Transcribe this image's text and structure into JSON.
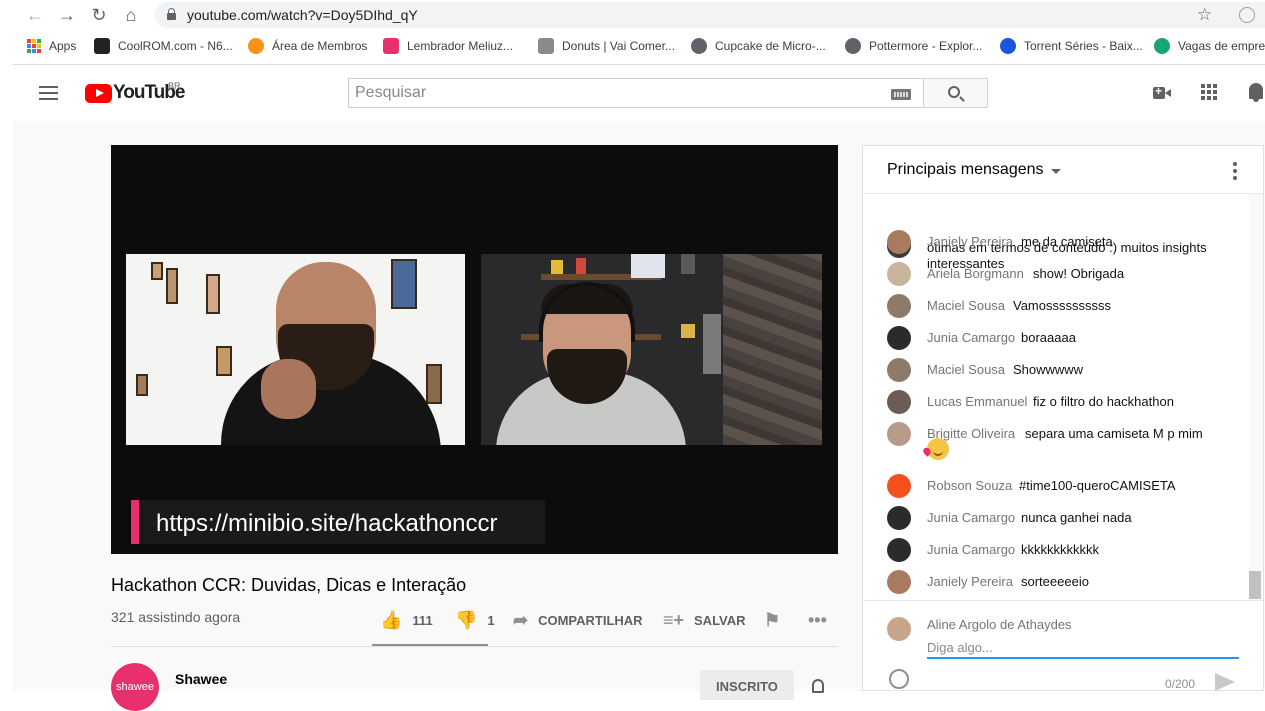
{
  "browser": {
    "url": "youtube.com/watch?v=Doy5DIhd_qY",
    "bookmarks": [
      {
        "label": "Apps",
        "icon": "apps-grid-icon",
        "color": "#ea4335"
      },
      {
        "label": "CoolROM.com - N6...",
        "icon": "coolrom-icon",
        "color": "#222222"
      },
      {
        "label": "Área de Membros",
        "icon": "bitcoin-icon",
        "color": "#f7931a"
      },
      {
        "label": "Lembrador Meliuz...",
        "icon": "meliuz-icon",
        "color": "#e8306e"
      },
      {
        "label": "Donuts | Vai Comer...",
        "icon": "donut-icon",
        "color": "#8a8a8a"
      },
      {
        "label": "Cupcake de Micro-...",
        "icon": "globe-icon",
        "color": "#5f6368"
      },
      {
        "label": "Pottermore - Explor...",
        "icon": "globe-icon",
        "color": "#5f6368"
      },
      {
        "label": "Torrent Séries - Baix...",
        "icon": "torrent-icon",
        "color": "#1a56db"
      },
      {
        "label": "Vagas de empreg",
        "icon": "check-circle-icon",
        "color": "#17a673"
      }
    ]
  },
  "youtube": {
    "logo_text": "YouTube",
    "region": "BR",
    "search_placeholder": "Pesquisar"
  },
  "video": {
    "banner_url": "https://minibio.site/hackathonccr",
    "title": "Hackathon CCR: Duvidas, Dicas e Interação",
    "view_count": "321 assistindo agora",
    "likes": "111",
    "dislikes": "1",
    "like_ratio": 0.991,
    "share_label": "COMPARTILHAR",
    "save_label": "SALVAR",
    "channel_name": "Shawee",
    "channel_avatar_text": "shawee",
    "subscribe_label": "INSCRITO"
  },
  "chat": {
    "title": "Principais mensagens",
    "partial_message": "ótimas em termos de conteúdo :) muitos insights interessantes",
    "messages": [
      {
        "author": "Janiely Pereira",
        "text": "me da camiseta",
        "avatar_color": "#a87a5e"
      },
      {
        "author": "Ariela Borgmann",
        "text": "show! Obrigada",
        "avatar_color": "#c9b49c"
      },
      {
        "author": "Maciel Sousa",
        "text": "Vamossssssssss",
        "avatar_color": "#8c7a6a"
      },
      {
        "author": "Junia Camargo",
        "text": "boraaaaa",
        "avatar_color": "#2b2b2b"
      },
      {
        "author": "Maciel Sousa",
        "text": "Showwwww",
        "avatar_color": "#8c7a6a"
      },
      {
        "author": "Lucas Emmanuel",
        "text": "fiz o filtro do hackhathon",
        "avatar_color": "#6b5d55"
      },
      {
        "author": "Brigitte Oliveira",
        "text": "separa uma camiseta M p mim",
        "avatar_color": "#b89a8a"
      },
      {
        "author": "Robson Souza",
        "text": "#time100-queroCAMISETA",
        "avatar_color": "#f4511e"
      },
      {
        "author": "Junia Camargo",
        "text": "nunca ganhei nada",
        "avatar_color": "#2b2b2b"
      },
      {
        "author": "Junia Camargo",
        "text": "kkkkkkkkkkkk",
        "avatar_color": "#2b2b2b"
      },
      {
        "author": "Janiely Pereira",
        "text": "sorteeeeeio",
        "avatar_color": "#a87a5e"
      }
    ],
    "current_user": "Aline Argolo de Athaydes",
    "input_placeholder": "Diga algo...",
    "char_count": "0/200"
  }
}
